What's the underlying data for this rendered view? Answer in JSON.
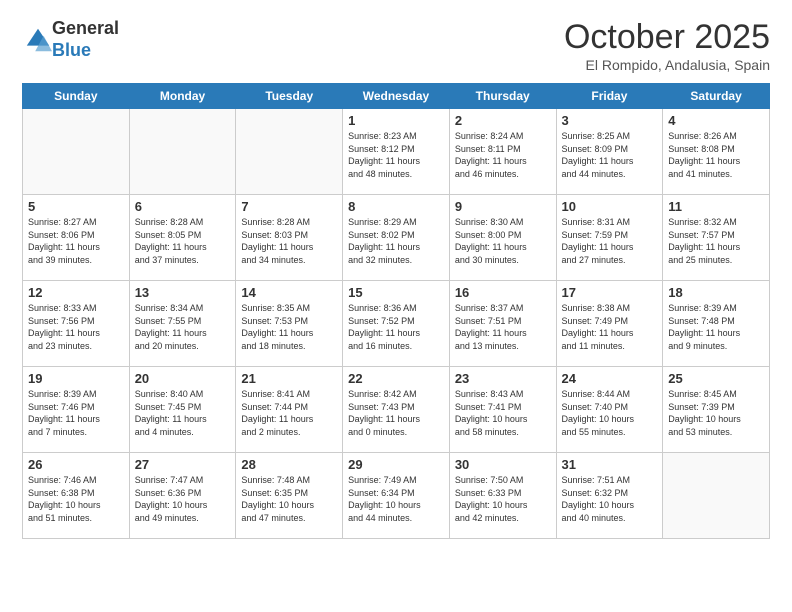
{
  "logo": {
    "general": "General",
    "blue": "Blue"
  },
  "title": "October 2025",
  "location": "El Rompido, Andalusia, Spain",
  "days": [
    "Sunday",
    "Monday",
    "Tuesday",
    "Wednesday",
    "Thursday",
    "Friday",
    "Saturday"
  ],
  "weeks": [
    [
      {
        "day": "",
        "info": ""
      },
      {
        "day": "",
        "info": ""
      },
      {
        "day": "",
        "info": ""
      },
      {
        "day": "1",
        "info": "Sunrise: 8:23 AM\nSunset: 8:12 PM\nDaylight: 11 hours\nand 48 minutes."
      },
      {
        "day": "2",
        "info": "Sunrise: 8:24 AM\nSunset: 8:11 PM\nDaylight: 11 hours\nand 46 minutes."
      },
      {
        "day": "3",
        "info": "Sunrise: 8:25 AM\nSunset: 8:09 PM\nDaylight: 11 hours\nand 44 minutes."
      },
      {
        "day": "4",
        "info": "Sunrise: 8:26 AM\nSunset: 8:08 PM\nDaylight: 11 hours\nand 41 minutes."
      }
    ],
    [
      {
        "day": "5",
        "info": "Sunrise: 8:27 AM\nSunset: 8:06 PM\nDaylight: 11 hours\nand 39 minutes."
      },
      {
        "day": "6",
        "info": "Sunrise: 8:28 AM\nSunset: 8:05 PM\nDaylight: 11 hours\nand 37 minutes."
      },
      {
        "day": "7",
        "info": "Sunrise: 8:28 AM\nSunset: 8:03 PM\nDaylight: 11 hours\nand 34 minutes."
      },
      {
        "day": "8",
        "info": "Sunrise: 8:29 AM\nSunset: 8:02 PM\nDaylight: 11 hours\nand 32 minutes."
      },
      {
        "day": "9",
        "info": "Sunrise: 8:30 AM\nSunset: 8:00 PM\nDaylight: 11 hours\nand 30 minutes."
      },
      {
        "day": "10",
        "info": "Sunrise: 8:31 AM\nSunset: 7:59 PM\nDaylight: 11 hours\nand 27 minutes."
      },
      {
        "day": "11",
        "info": "Sunrise: 8:32 AM\nSunset: 7:57 PM\nDaylight: 11 hours\nand 25 minutes."
      }
    ],
    [
      {
        "day": "12",
        "info": "Sunrise: 8:33 AM\nSunset: 7:56 PM\nDaylight: 11 hours\nand 23 minutes."
      },
      {
        "day": "13",
        "info": "Sunrise: 8:34 AM\nSunset: 7:55 PM\nDaylight: 11 hours\nand 20 minutes."
      },
      {
        "day": "14",
        "info": "Sunrise: 8:35 AM\nSunset: 7:53 PM\nDaylight: 11 hours\nand 18 minutes."
      },
      {
        "day": "15",
        "info": "Sunrise: 8:36 AM\nSunset: 7:52 PM\nDaylight: 11 hours\nand 16 minutes."
      },
      {
        "day": "16",
        "info": "Sunrise: 8:37 AM\nSunset: 7:51 PM\nDaylight: 11 hours\nand 13 minutes."
      },
      {
        "day": "17",
        "info": "Sunrise: 8:38 AM\nSunset: 7:49 PM\nDaylight: 11 hours\nand 11 minutes."
      },
      {
        "day": "18",
        "info": "Sunrise: 8:39 AM\nSunset: 7:48 PM\nDaylight: 11 hours\nand 9 minutes."
      }
    ],
    [
      {
        "day": "19",
        "info": "Sunrise: 8:39 AM\nSunset: 7:46 PM\nDaylight: 11 hours\nand 7 minutes."
      },
      {
        "day": "20",
        "info": "Sunrise: 8:40 AM\nSunset: 7:45 PM\nDaylight: 11 hours\nand 4 minutes."
      },
      {
        "day": "21",
        "info": "Sunrise: 8:41 AM\nSunset: 7:44 PM\nDaylight: 11 hours\nand 2 minutes."
      },
      {
        "day": "22",
        "info": "Sunrise: 8:42 AM\nSunset: 7:43 PM\nDaylight: 11 hours\nand 0 minutes."
      },
      {
        "day": "23",
        "info": "Sunrise: 8:43 AM\nSunset: 7:41 PM\nDaylight: 10 hours\nand 58 minutes."
      },
      {
        "day": "24",
        "info": "Sunrise: 8:44 AM\nSunset: 7:40 PM\nDaylight: 10 hours\nand 55 minutes."
      },
      {
        "day": "25",
        "info": "Sunrise: 8:45 AM\nSunset: 7:39 PM\nDaylight: 10 hours\nand 53 minutes."
      }
    ],
    [
      {
        "day": "26",
        "info": "Sunrise: 7:46 AM\nSunset: 6:38 PM\nDaylight: 10 hours\nand 51 minutes."
      },
      {
        "day": "27",
        "info": "Sunrise: 7:47 AM\nSunset: 6:36 PM\nDaylight: 10 hours\nand 49 minutes."
      },
      {
        "day": "28",
        "info": "Sunrise: 7:48 AM\nSunset: 6:35 PM\nDaylight: 10 hours\nand 47 minutes."
      },
      {
        "day": "29",
        "info": "Sunrise: 7:49 AM\nSunset: 6:34 PM\nDaylight: 10 hours\nand 44 minutes."
      },
      {
        "day": "30",
        "info": "Sunrise: 7:50 AM\nSunset: 6:33 PM\nDaylight: 10 hours\nand 42 minutes."
      },
      {
        "day": "31",
        "info": "Sunrise: 7:51 AM\nSunset: 6:32 PM\nDaylight: 10 hours\nand 40 minutes."
      },
      {
        "day": "",
        "info": ""
      }
    ]
  ]
}
